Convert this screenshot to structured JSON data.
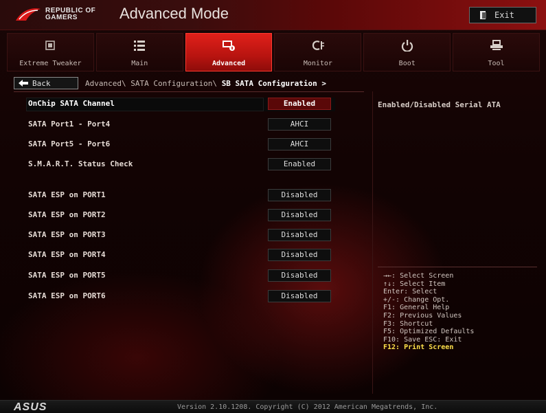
{
  "header": {
    "brand_line1": "REPUBLIC OF",
    "brand_line2": "GAMERS",
    "mode_title": "Advanced Mode",
    "exit_label": "Exit"
  },
  "tabs": [
    {
      "label": "Extreme Tweaker",
      "icon": "tweaker-icon",
      "active": false
    },
    {
      "label": "Main",
      "icon": "list-icon",
      "active": false
    },
    {
      "label": "Advanced",
      "icon": "advanced-icon",
      "active": true
    },
    {
      "label": "Monitor",
      "icon": "monitor-icon",
      "active": false
    },
    {
      "label": "Boot",
      "icon": "power-icon",
      "active": false
    },
    {
      "label": "Tool",
      "icon": "tool-icon",
      "active": false
    }
  ],
  "breadcrumb": {
    "back_label": "Back",
    "path": "Advanced\\ SATA Configuration\\",
    "current": "SB SATA Configuration >"
  },
  "settings": [
    {
      "label": "OnChip SATA Channel",
      "value": "Enabled",
      "selected": true
    },
    {
      "label": "SATA Port1 - Port4",
      "value": "AHCI",
      "selected": false
    },
    {
      "label": "SATA Port5 - Port6",
      "value": "AHCI",
      "selected": false
    },
    {
      "label": "S.M.A.R.T. Status Check",
      "value": "Enabled",
      "selected": false
    },
    {
      "label": "SATA ESP on PORT1",
      "value": "Disabled",
      "selected": false
    },
    {
      "label": "SATA ESP on PORT2",
      "value": "Disabled",
      "selected": false
    },
    {
      "label": "SATA ESP on PORT3",
      "value": "Disabled",
      "selected": false
    },
    {
      "label": "SATA ESP on PORT4",
      "value": "Disabled",
      "selected": false
    },
    {
      "label": "SATA ESP on PORT5",
      "value": "Disabled",
      "selected": false
    },
    {
      "label": "SATA ESP on PORT6",
      "value": "Disabled",
      "selected": false
    }
  ],
  "help": {
    "description": "Enabled/Disabled Serial ATA",
    "keys": [
      "→←: Select Screen",
      "↑↓: Select Item",
      "Enter: Select",
      "+/-: Change Opt.",
      "F1: General Help",
      "F2: Previous Values",
      "F3: Shortcut",
      "F5: Optimized Defaults",
      "F10: Save  ESC: Exit",
      "F12: Print Screen"
    ]
  },
  "footer": {
    "logo": "ASUS",
    "version": "Version 2.10.1208. Copyright (C) 2012 American Megatrends, Inc."
  },
  "colors": {
    "accent": "#d01a14",
    "highlight_key": "#ffe14a"
  }
}
